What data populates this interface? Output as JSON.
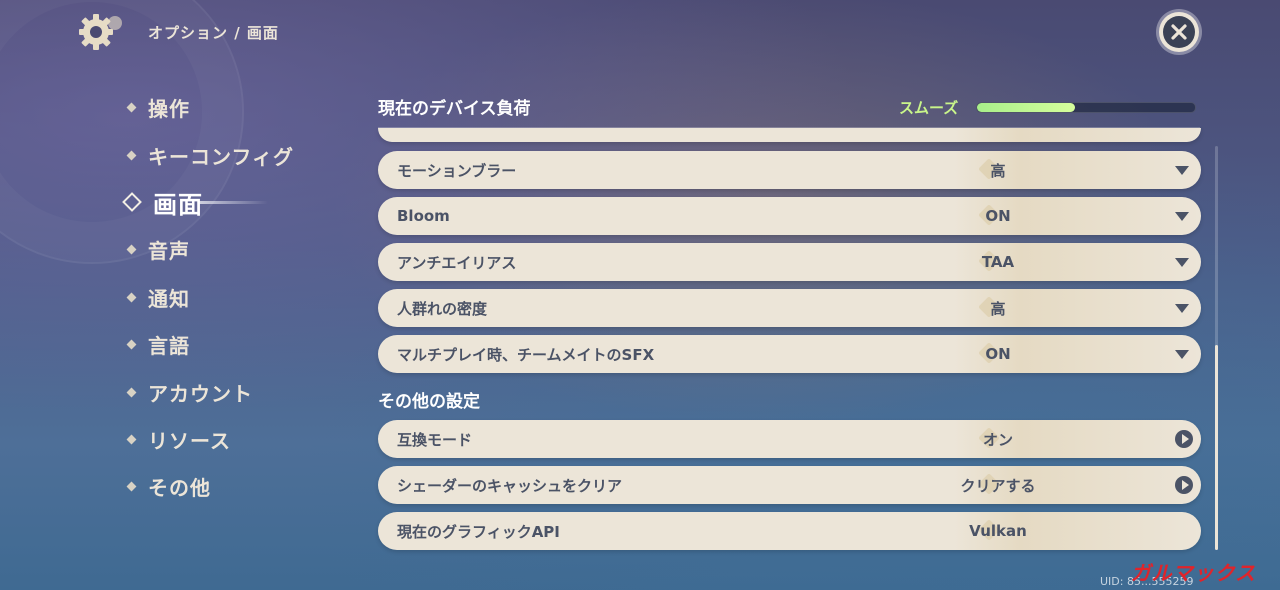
{
  "header": {
    "breadcrumb": "オプション / 画面"
  },
  "sidebar": {
    "items": [
      {
        "label": "操作"
      },
      {
        "label": "キーコンフィグ"
      },
      {
        "label": "画面"
      },
      {
        "label": "音声"
      },
      {
        "label": "通知"
      },
      {
        "label": "言語"
      },
      {
        "label": "アカウント"
      },
      {
        "label": "リソース"
      },
      {
        "label": "その他"
      }
    ],
    "active_index": 2
  },
  "device_load": {
    "title": "現在のデバイス負荷",
    "status": "スムーズ",
    "level_percent": 45,
    "color": "#b8f590"
  },
  "settings": [
    {
      "label": "モーションブラー",
      "value": "高",
      "control": "dropdown"
    },
    {
      "label": "Bloom",
      "value": "ON",
      "control": "dropdown"
    },
    {
      "label": "アンチエイリアス",
      "value": "TAA",
      "control": "dropdown"
    },
    {
      "label": "人群れの密度",
      "value": "高",
      "control": "dropdown"
    },
    {
      "label": "マルチプレイ時、チームメイトのSFX",
      "value": "ON",
      "control": "dropdown"
    }
  ],
  "other_section": {
    "title": "その他の設定",
    "items": [
      {
        "label": "互換モード",
        "value": "オン",
        "control": "action"
      },
      {
        "label": "シェーダーのキャッシュをクリア",
        "value": "クリアする",
        "control": "action"
      },
      {
        "label": "現在のグラフィックAPI",
        "value": "Vulkan",
        "control": "none"
      }
    ]
  },
  "footer": {
    "uid": "UID: 85...555259",
    "watermark": "ガルマックス"
  },
  "icons": {
    "settings": "gear-icon",
    "close": "close-icon",
    "dropdown": "chevron-down-icon",
    "action": "play-circle-icon"
  }
}
